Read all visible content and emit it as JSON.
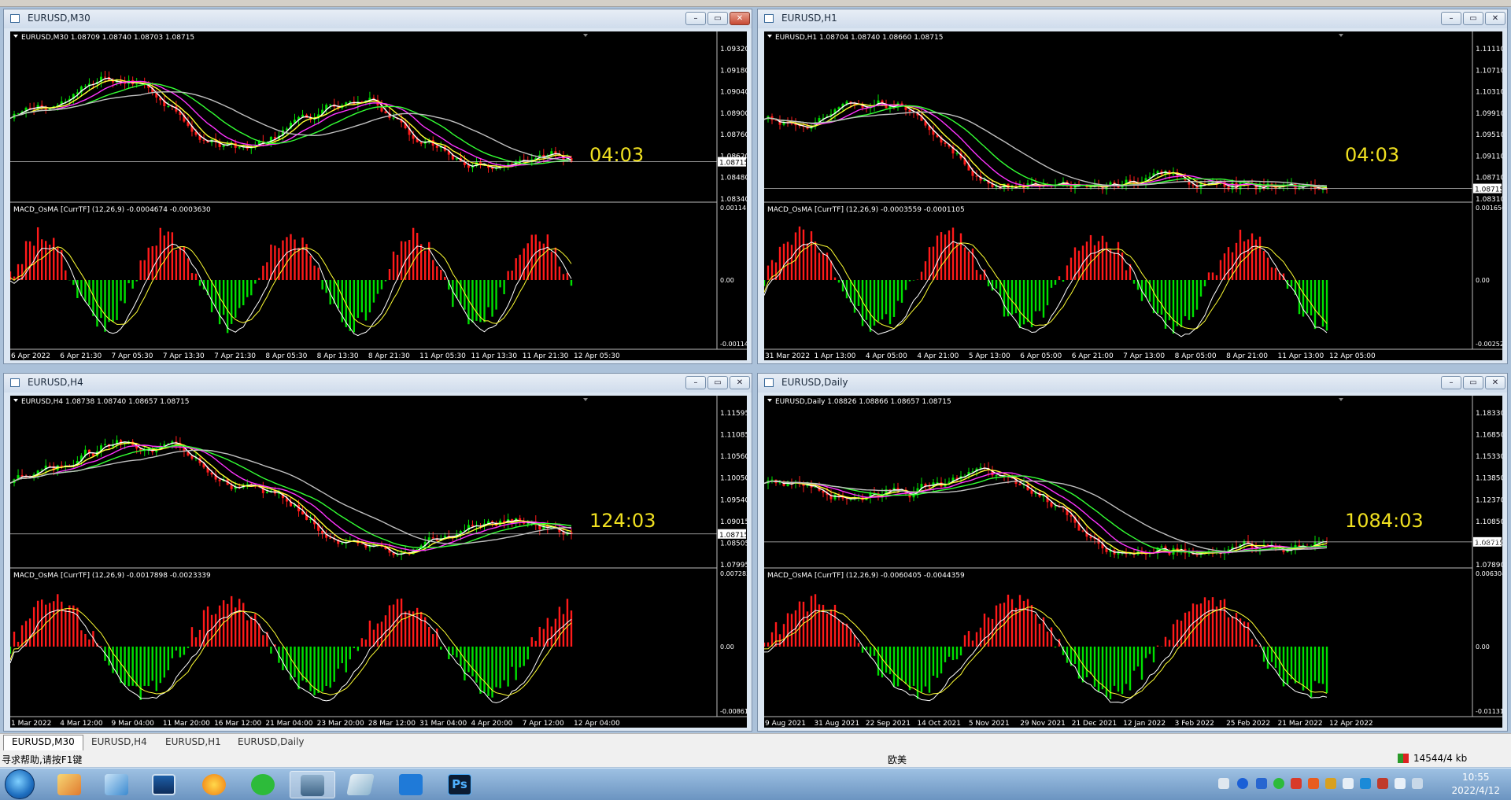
{
  "windows": [
    {
      "id": "m30",
      "title": "EURUSD,M30",
      "header": "EURUSD,M30  1.08709 1.08740 1.08703 1.08715",
      "timer": "04:03",
      "price_labels": [
        "1.09320",
        "1.09180",
        "1.09040",
        "1.08900",
        "1.08760",
        "1.08620",
        "1.08480",
        "1.08340"
      ],
      "current_price": "1.08715",
      "macd_header": "MACD_OsMA [CurrTF] (12,26,9) -0.0004674 -0.0003630",
      "macd_labels": [
        "0.0011418",
        "0.00",
        "-0.0011418"
      ],
      "time_labels": [
        "6 Apr 2022",
        "6 Apr 21:30",
        "7 Apr 05:30",
        "7 Apr 13:30",
        "7 Apr 21:30",
        "8 Apr 05:30",
        "8 Apr 13:30",
        "8 Apr 21:30",
        "11 Apr 05:30",
        "11 Apr 13:30",
        "11 Apr 21:30",
        "12 Apr 05:30"
      ],
      "active": true
    },
    {
      "id": "h1",
      "title": "EURUSD,H1",
      "header": "EURUSD,H1  1.08704 1.08740 1.08660 1.08715",
      "timer": "04:03",
      "price_labels": [
        "1.11110",
        "1.10710",
        "1.10310",
        "1.09910",
        "1.09510",
        "1.09110",
        "1.08710",
        "1.08310"
      ],
      "current_price": "1.08715",
      "macd_header": "MACD_OsMA [CurrTF] (12,26,9) -0.0003559 -0.0001105",
      "macd_labels": [
        "0.0016565",
        "0.00",
        "-0.0025215"
      ],
      "time_labels": [
        "31 Mar 2022",
        "1 Apr 13:00",
        "4 Apr 05:00",
        "4 Apr 21:00",
        "5 Apr 13:00",
        "6 Apr 05:00",
        "6 Apr 21:00",
        "7 Apr 13:00",
        "8 Apr 05:00",
        "8 Apr 21:00",
        "11 Apr 13:00",
        "12 Apr 05:00"
      ],
      "active": false
    },
    {
      "id": "h4",
      "title": "EURUSD,H4",
      "header": "EURUSD,H4  1.08738 1.08740 1.08657 1.08715",
      "timer": "124:03",
      "price_labels": [
        "1.11595",
        "1.11085",
        "1.10560",
        "1.10050",
        "1.09540",
        "1.09015",
        "1.08505",
        "1.07995"
      ],
      "current_price": "1.08715",
      "macd_header": "MACD_OsMA [CurrTF] (12,26,9) -0.0017898 -0.0023339",
      "macd_labels": [
        "0.0072832",
        "0.00",
        "-0.00861"
      ],
      "time_labels": [
        "1 Mar 2022",
        "4 Mar 12:00",
        "9 Mar 04:00",
        "11 Mar 20:00",
        "16 Mar 12:00",
        "21 Mar 04:00",
        "23 Mar 20:00",
        "28 Mar 12:00",
        "31 Mar 04:00",
        "4 Apr 20:00",
        "7 Apr 12:00",
        "12 Apr 04:00"
      ],
      "active": false
    },
    {
      "id": "daily",
      "title": "EURUSD,Daily",
      "header": "EURUSD,Daily  1.08826 1.08866 1.08657 1.08715",
      "timer": "1084:03",
      "price_labels": [
        "1.18330",
        "1.16850",
        "1.15330",
        "1.13850",
        "1.12370",
        "1.10850",
        "1.09370",
        "1.07890"
      ],
      "current_price": "1.08715",
      "macd_header": "MACD_OsMA [CurrTF] (12,26,9) -0.0060405 -0.0044359",
      "macd_labels": [
        "0.0063042",
        "0.00",
        "-0.0113126"
      ],
      "time_labels": [
        "9 Aug 2021",
        "31 Aug 2021",
        "22 Sep 2021",
        "14 Oct 2021",
        "5 Nov 2021",
        "29 Nov 2021",
        "21 Dec 2021",
        "12 Jan 2022",
        "3 Feb 2022",
        "25 Feb 2022",
        "21 Mar 2022",
        "12 Apr 2022"
      ],
      "active": false
    }
  ],
  "window_controls": {
    "minimize": "–",
    "maximize": "▭",
    "close": "✕"
  },
  "tabs": [
    {
      "label": "EURUSD,M30",
      "active": true
    },
    {
      "label": "EURUSD,H4",
      "active": false
    },
    {
      "label": "EURUSD,H1",
      "active": false
    },
    {
      "label": "EURUSD,Daily",
      "active": false
    }
  ],
  "status_bar": {
    "help_text": "寻求帮助,请按F1键",
    "profile": "欧美",
    "connection": "14544/4 kb"
  },
  "taskbar": {
    "apps": [
      "start-orb",
      "folder-app",
      "explorer-app",
      "desktop-app",
      "browser-app",
      "wechat-app",
      "mt4-app",
      "notebook-app",
      "pen-app",
      "photoshop-app"
    ],
    "photoshop_label": "Ps",
    "clock_time": "10:55",
    "clock_date": "2022/4/12"
  },
  "colors": {
    "chart_bg": "#000000",
    "bull": "#00e000",
    "bear": "#ff1a1a",
    "ma_fast": "#ffffff",
    "ma_yellow": "#ffff33",
    "ma_magenta": "#ff33ff",
    "ma_green": "#33ff33",
    "ma_gray": "#c0c0c0",
    "timer": "#f0e020",
    "hline": "#c8c8c8"
  }
}
